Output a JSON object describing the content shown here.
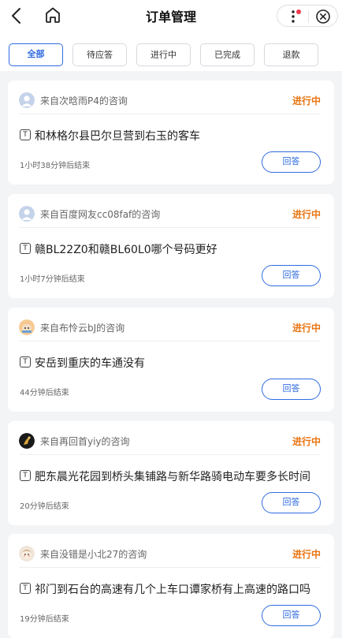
{
  "header": {
    "title": "订单管理",
    "back_icon": "chevron-left-icon",
    "home_icon": "home-icon",
    "more_icon": "more-vertical-icon",
    "close_icon": "close-circle-icon"
  },
  "tabs": [
    {
      "label": "全部",
      "active": true
    },
    {
      "label": "待应答",
      "active": false
    },
    {
      "label": "进行中",
      "active": false
    },
    {
      "label": "已完成",
      "active": false
    },
    {
      "label": "退款",
      "active": false
    }
  ],
  "orders": [
    {
      "from": "来自次晗雨P4的咨询",
      "status": "进行中",
      "question": "和林格尔县巴尔旦营到右玉的客车",
      "time": "1小时38分钟后结束",
      "answer_label": "回答"
    },
    {
      "from": "来自百度网友cc08faf的咨询",
      "status": "进行中",
      "question": "赣BL22Z0和赣BL60L0哪个号码更好",
      "time": "1小时7分钟后结束",
      "answer_label": "回答"
    },
    {
      "from": "来自布怜云bJ的咨询",
      "status": "进行中",
      "question": "安岳到重庆的车通没有",
      "time": "44分钟后结束",
      "answer_label": "回答"
    },
    {
      "from": "来自再回首yiy的咨询",
      "status": "进行中",
      "question": "肥东晨光花园到桥头集铺路与新华路骑电动车要多长时间",
      "time": "20分钟后结束",
      "answer_label": "回答"
    },
    {
      "from": "来自没错是小北27的咨询",
      "status": "进行中",
      "question": "祁门到石台的高速有几个上车口谭家桥有上高速的路口吗",
      "time": "19分钟后结束",
      "answer_label": "回答"
    }
  ],
  "colors": {
    "accent": "#2f6be0",
    "status": "#e97512",
    "background": "#f3f4f6"
  }
}
